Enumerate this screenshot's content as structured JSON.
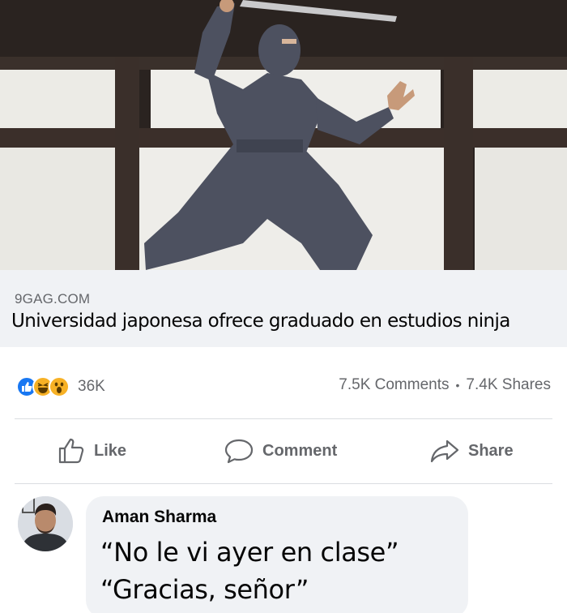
{
  "post": {
    "image_icon": "ninja-photo",
    "link": {
      "domain": "9GAG.COM",
      "title": "Universidad japonesa ofrece graduado en estudios ninja"
    },
    "reactions": {
      "icons": [
        "like-reaction-icon",
        "haha-reaction-icon",
        "wow-reaction-icon"
      ],
      "count": "36K"
    },
    "comments_count": "7.5K Comments",
    "separator": "•",
    "shares_count": "7.4K Shares"
  },
  "actions": {
    "like_label": "Like",
    "comment_label": "Comment",
    "share_label": "Share"
  },
  "comment": {
    "author": "Aman Sharma",
    "line1": "“No le vi ayer en clase”",
    "line2": "“Gracias, señor”"
  },
  "colors": {
    "facebook_blue": "#1877f2",
    "secondary_text": "#65676b",
    "reaction_yellow": "#f7b125"
  }
}
